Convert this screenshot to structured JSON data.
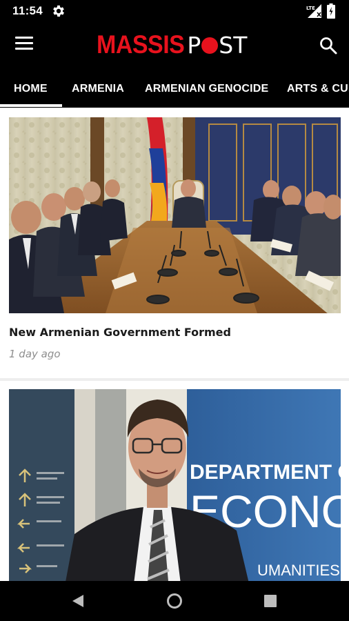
{
  "status_bar": {
    "time": "11:54",
    "icons": [
      "gear-icon",
      "signal-icon",
      "battery-icon"
    ],
    "signal_label": "LTE"
  },
  "header": {
    "logo_part1": "MASSIS",
    "logo_part2a": "P",
    "logo_part2b": "ST",
    "menu_icon": "hamburger-menu-icon",
    "search_icon": "search-icon",
    "brand_color": "#e8121d"
  },
  "tabs": [
    {
      "label": "HOME",
      "active": true
    },
    {
      "label": "ARMENIA",
      "active": false
    },
    {
      "label": "ARMENIAN GENOCIDE",
      "active": false
    },
    {
      "label": "ARTS & CUL",
      "active": false
    }
  ],
  "articles": [
    {
      "title": "New Armenian Government Formed",
      "time": "1 day ago",
      "image": "government-meeting-photo"
    },
    {
      "title": "",
      "time": "",
      "image": "economist-portrait-photo",
      "image_text": [
        "DEPARTMENT OF",
        "ECONOM",
        "UMANITIES, A"
      ]
    }
  ],
  "nav_bar": {
    "icons": [
      "back-icon",
      "home-icon",
      "recent-apps-icon"
    ]
  }
}
